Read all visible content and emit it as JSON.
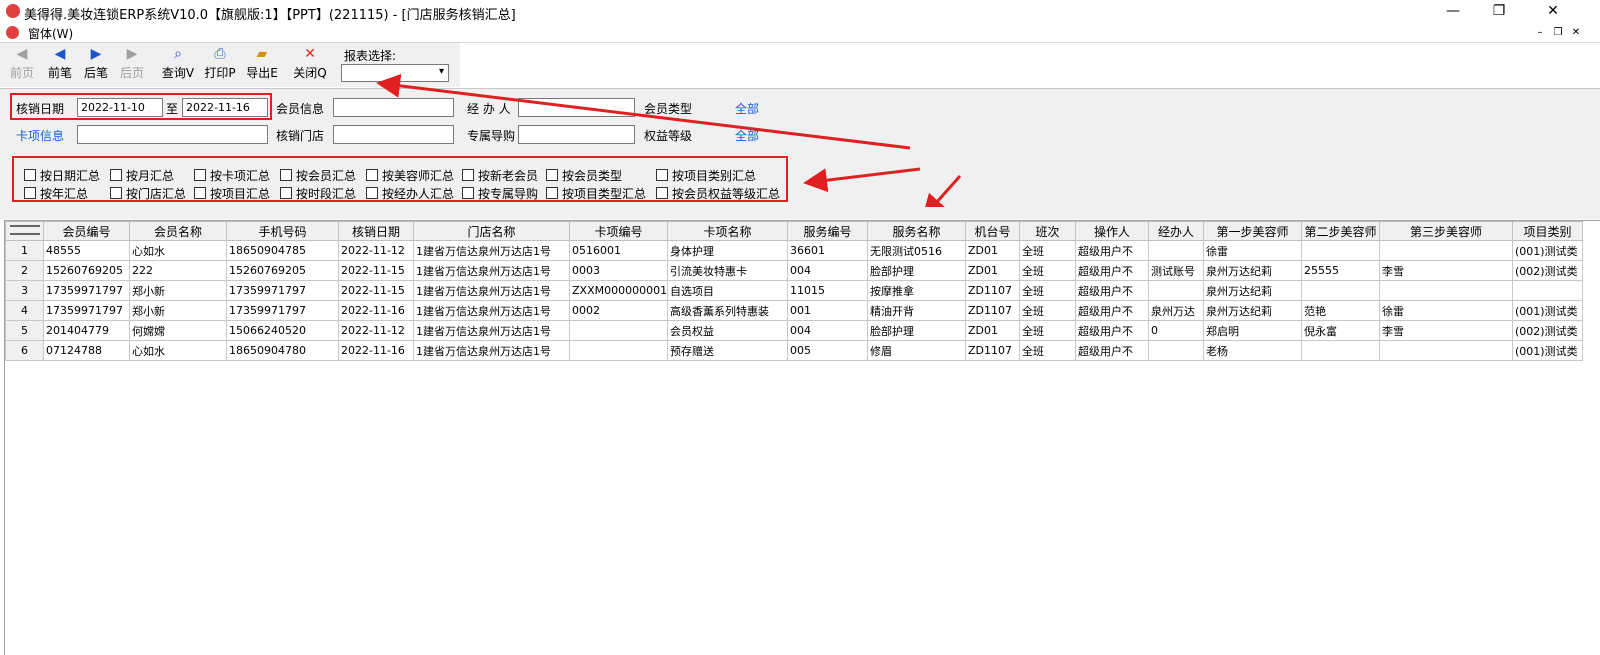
{
  "window": {
    "title": "美得得.美妆连锁ERP系统V10.0【旗舰版:1】【PPT】(221115) - [门店服务核销汇总]",
    "minimize": "—",
    "maximize": "❐",
    "close": "✕"
  },
  "menubar": {
    "window_menu": "窗体(W)",
    "mdi_min": "–",
    "mdi_restore": "❐",
    "mdi_close": "✕"
  },
  "toolbar": {
    "first": "前页",
    "prev": "前笔",
    "next": "后笔",
    "last": "后页",
    "query": "查询V",
    "print": "打印P",
    "export": "导出E",
    "close": "关闭Q",
    "report_label": "报表选择:",
    "report_value": ""
  },
  "filters": {
    "date_label": "核销日期",
    "date_from": "2022-11-10",
    "date_to_label": "至",
    "date_to": "2022-11-16",
    "member_info_label": "会员信息",
    "member_info_value": "",
    "handler_label": "经 办 人",
    "handler_value": "",
    "member_type_label": "会员类型",
    "member_type_value": "全部",
    "card_item_label": "卡项信息",
    "card_item_value": "",
    "store_label": "核销门店",
    "store_value": "",
    "guide_label": "专属导购",
    "guide_value": "",
    "rights_level_label": "权益等级",
    "rights_level_value": "全部"
  },
  "summary_options": [
    "按日期汇总",
    "按月汇总",
    "按卡项汇总",
    "按会员汇总",
    "按美容师汇总",
    "按新老会员",
    "按会员类型",
    "按项目类别汇总",
    "按年汇总",
    "按门店汇总",
    "按项目汇总",
    "按时段汇总",
    "按经办人汇总",
    "按专属导购",
    "按项目类型汇总",
    "按会员权益等级汇总"
  ],
  "table": {
    "columns": [
      "会员编号",
      "会员名称",
      "手机号码",
      "核销日期",
      "门店名称",
      "卡项编号",
      "卡项名称",
      "服务编号",
      "服务名称",
      "机台号",
      "班次",
      "操作人",
      "经办人",
      "第一步美容师",
      "第二步美容师",
      "第三步美容师",
      "项目类别"
    ],
    "rows": [
      [
        "1",
        "48555",
        "心如水",
        "18650904785",
        "2022-11-12",
        "1建省万信达泉州万达店1号",
        "0516001",
        "身体护理",
        "36601",
        "无限测试0516",
        "ZD01",
        "全班",
        "超级用户不",
        "",
        "徐雷",
        "",
        "",
        "(001)测试类"
      ],
      [
        "2",
        "15260769205",
        "222",
        "15260769205",
        "2022-11-15",
        "1建省万信达泉州万达店1号",
        "0003",
        "引流美妆特惠卡",
        "004",
        "脸部护理",
        "ZD01",
        "全班",
        "超级用户不",
        "测试账号",
        "泉州万达纪莉",
        "25555",
        "李雪",
        "(002)测试类"
      ],
      [
        "3",
        "17359971797",
        "郑小新",
        "17359971797",
        "2022-11-15",
        "1建省万信达泉州万达店1号",
        "ZXXM000000001",
        "自选项目",
        "11015",
        "按摩推拿",
        "ZD1107",
        "全班",
        "超级用户不",
        "",
        "泉州万达纪莉",
        "",
        "",
        ""
      ],
      [
        "4",
        "17359971797",
        "郑小新",
        "17359971797",
        "2022-11-16",
        "1建省万信达泉州万达店1号",
        "0002",
        "高级香薰系列特惠装",
        "001",
        "精油开背",
        "ZD1107",
        "全班",
        "超级用户不",
        "泉州万达",
        "泉州万达纪莉",
        "范艳",
        "徐雷",
        "(001)测试类"
      ],
      [
        "5",
        "201404779",
        "何嫦嫦",
        "15066240520",
        "2022-11-12",
        "1建省万信达泉州万达店1号",
        "",
        "会员权益",
        "004",
        "脸部护理",
        "ZD01",
        "全班",
        "超级用户不",
        "0",
        "郑启明",
        "倪永富",
        "李雪",
        "(002)测试类"
      ],
      [
        "6",
        "07124788",
        "心如水",
        "18650904780",
        "2022-11-16",
        "1建省万信达泉州万达店1号",
        "",
        "预存赠送",
        "005",
        "修眉",
        "ZD1107",
        "全班",
        "超级用户不",
        "",
        "老杨",
        "",
        "",
        "(001)测试类"
      ]
    ]
  },
  "colors": {
    "annotation": "#e02020",
    "link_blue": "#1060d0"
  }
}
